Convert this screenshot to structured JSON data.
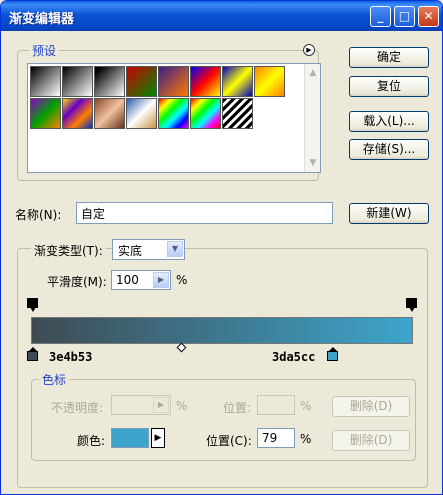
{
  "window": {
    "title": "渐变编辑器"
  },
  "title_buttons": {
    "minimize": "_",
    "maximize": "□",
    "close": "✕"
  },
  "presets": {
    "label": "预设",
    "swatches": [
      {
        "name": "black-white",
        "gradient": "linear-gradient(135deg,#000,#fff)"
      },
      {
        "name": "foreground-transparent",
        "gradient": "linear-gradient(135deg,#000,rgba(0,0,0,0))"
      },
      {
        "name": "black-white-2",
        "gradient": "linear-gradient(135deg,#000 10%,#fff)"
      },
      {
        "name": "red-green",
        "gradient": "linear-gradient(135deg,#c80000,#008c00)"
      },
      {
        "name": "violet-orange",
        "gradient": "linear-gradient(135deg,#3b1f8c,#ff7a00)"
      },
      {
        "name": "blue-red-yellow",
        "gradient": "linear-gradient(135deg,#0000ff,#ff0000,#ffff00)"
      },
      {
        "name": "blue-yellow-blue",
        "gradient": "linear-gradient(135deg,#0000c0,#ffff00,#0000c0)"
      },
      {
        "name": "orange-yellow-orange",
        "gradient": "linear-gradient(135deg,#ff8000,#ffff00,#ff8000)"
      },
      {
        "name": "violet-green-orange",
        "gradient": "linear-gradient(135deg,#8c00c8,#00a000,#ff8000)"
      },
      {
        "name": "yellow-violet-orange-blue",
        "gradient": "linear-gradient(135deg,#ffd800,#6a00c8,#ff8000,#0030c8)"
      },
      {
        "name": "copper",
        "gradient": "linear-gradient(135deg,#8c4a2a,#f0c0a0,#6a3018)"
      },
      {
        "name": "chrome",
        "gradient": "linear-gradient(135deg,#2a5ca8,#fff 50%,#c89040)"
      },
      {
        "name": "spectrum",
        "gradient": "linear-gradient(135deg,#ff0000,#ffff00,#00ff00,#00ffff,#0000ff,#ff00ff)"
      },
      {
        "name": "transparent-rainbow",
        "gradient": "linear-gradient(135deg,#ff0000,#ffff00,#00ff00,#00ffff,#ff00ff,#ff0000)"
      },
      {
        "name": "transparent-stripes",
        "gradient": "repeating-linear-gradient(135deg,#000 0 3px,#fff 3px 6px)"
      }
    ]
  },
  "buttons": {
    "ok": "确定",
    "reset": "复位",
    "load": "载入(L)...",
    "save": "存储(S)...",
    "new": "新建(W)",
    "delete_opacity": "删除(D)",
    "delete_color": "删除(D)"
  },
  "name_field": {
    "label": "名称(N):",
    "value": "自定"
  },
  "gradient_type": {
    "label": "渐变类型(T):",
    "value": "实底"
  },
  "smoothness": {
    "label": "平滑度(M):",
    "value": "100",
    "unit": "%"
  },
  "gradient": {
    "start_color": "#3e4b53",
    "end_color": "#3da5cc",
    "start_hex": "3e4b53",
    "end_hex": "3da5cc"
  },
  "color_stops": {
    "label": "色标",
    "opacity_label": "不透明度:",
    "opacity_unit": "%",
    "opacity_location_label": "位置:",
    "opacity_location_unit": "%",
    "color_label": "颜色:",
    "color_value": "#3da5cc",
    "location_label": "位置(C):",
    "location_value": "79",
    "location_unit": "%"
  }
}
